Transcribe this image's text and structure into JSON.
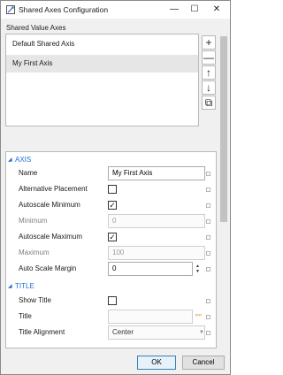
{
  "window": {
    "title": "Shared Axes Configuration",
    "minimize": "—",
    "maximize": "☐",
    "close": "✕"
  },
  "list_section": {
    "caption": "Shared Value Axes",
    "items": [
      {
        "label": "Default Shared Axis",
        "selected": false
      },
      {
        "label": "My First Axis",
        "selected": true
      }
    ],
    "buttons": {
      "add": "+",
      "remove": "—",
      "up": "↑",
      "down": "↓",
      "copy": "⧉"
    }
  },
  "grid": {
    "categories": {
      "axis": "AXIS",
      "title": "TITLE"
    },
    "axis_rows": {
      "name": {
        "label": "Name",
        "value": "My First Axis"
      },
      "alternative_placement": {
        "label": "Alternative Placement",
        "checked": false
      },
      "autoscale_minimum": {
        "label": "Autoscale Minimum",
        "checked": true
      },
      "minimum": {
        "label": "Minimum",
        "value": "0"
      },
      "autoscale_maximum": {
        "label": "Autoscale Maximum",
        "checked": true
      },
      "maximum": {
        "label": "Maximum",
        "value": "100"
      },
      "auto_scale_margin": {
        "label": "Auto Scale Margin",
        "value": "0"
      }
    },
    "title_rows": {
      "show_title": {
        "label": "Show Title",
        "checked": false
      },
      "title": {
        "label": "Title",
        "value": ""
      },
      "title_alignment": {
        "label": "Title Alignment",
        "value": "Center"
      }
    }
  },
  "footer": {
    "ok": "OK",
    "cancel": "Cancel"
  }
}
